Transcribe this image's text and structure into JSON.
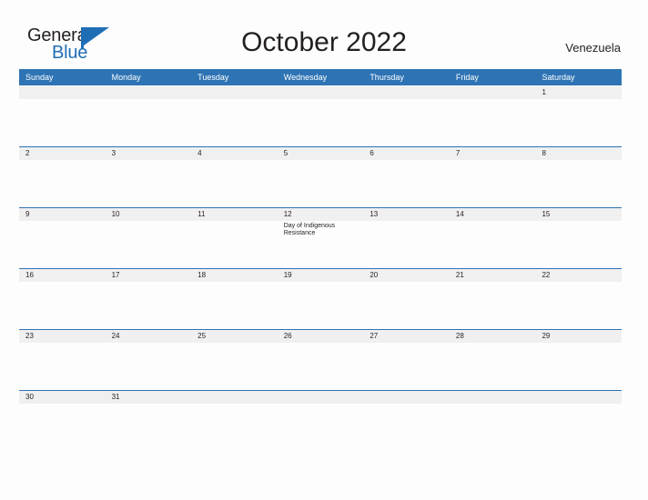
{
  "brand": {
    "word_one": "General",
    "word_two": "Blue",
    "mark": "triangle-logo-icon",
    "color_dark": "#231f20",
    "color_blue": "#1f6eb5"
  },
  "header": {
    "title": "October 2022",
    "country": "Venezuela"
  },
  "theme": {
    "header_blue": "#2e74b5",
    "rule_blue": "#2e74b5",
    "date_band_gray": "#f0f0f0",
    "page_background": "#fdfdfd",
    "text": "#231f20"
  },
  "calendar": {
    "weekday_headers": [
      "Sunday",
      "Monday",
      "Tuesday",
      "Wednesday",
      "Thursday",
      "Friday",
      "Saturday"
    ],
    "weeks": [
      {
        "days": [
          {
            "num": "",
            "event": ""
          },
          {
            "num": "",
            "event": ""
          },
          {
            "num": "",
            "event": ""
          },
          {
            "num": "",
            "event": ""
          },
          {
            "num": "",
            "event": ""
          },
          {
            "num": "",
            "event": ""
          },
          {
            "num": "1",
            "event": ""
          }
        ]
      },
      {
        "days": [
          {
            "num": "2",
            "event": ""
          },
          {
            "num": "3",
            "event": ""
          },
          {
            "num": "4",
            "event": ""
          },
          {
            "num": "5",
            "event": ""
          },
          {
            "num": "6",
            "event": ""
          },
          {
            "num": "7",
            "event": ""
          },
          {
            "num": "8",
            "event": ""
          }
        ]
      },
      {
        "days": [
          {
            "num": "9",
            "event": ""
          },
          {
            "num": "10",
            "event": ""
          },
          {
            "num": "11",
            "event": ""
          },
          {
            "num": "12",
            "event": "Day of Indigenous Resistance"
          },
          {
            "num": "13",
            "event": ""
          },
          {
            "num": "14",
            "event": ""
          },
          {
            "num": "15",
            "event": ""
          }
        ]
      },
      {
        "days": [
          {
            "num": "16",
            "event": ""
          },
          {
            "num": "17",
            "event": ""
          },
          {
            "num": "18",
            "event": ""
          },
          {
            "num": "19",
            "event": ""
          },
          {
            "num": "20",
            "event": ""
          },
          {
            "num": "21",
            "event": ""
          },
          {
            "num": "22",
            "event": ""
          }
        ]
      },
      {
        "days": [
          {
            "num": "23",
            "event": ""
          },
          {
            "num": "24",
            "event": ""
          },
          {
            "num": "25",
            "event": ""
          },
          {
            "num": "26",
            "event": ""
          },
          {
            "num": "27",
            "event": ""
          },
          {
            "num": "28",
            "event": ""
          },
          {
            "num": "29",
            "event": ""
          }
        ]
      },
      {
        "days": [
          {
            "num": "30",
            "event": ""
          },
          {
            "num": "31",
            "event": ""
          },
          {
            "num": "",
            "event": ""
          },
          {
            "num": "",
            "event": ""
          },
          {
            "num": "",
            "event": ""
          },
          {
            "num": "",
            "event": ""
          },
          {
            "num": "",
            "event": ""
          }
        ]
      }
    ]
  }
}
